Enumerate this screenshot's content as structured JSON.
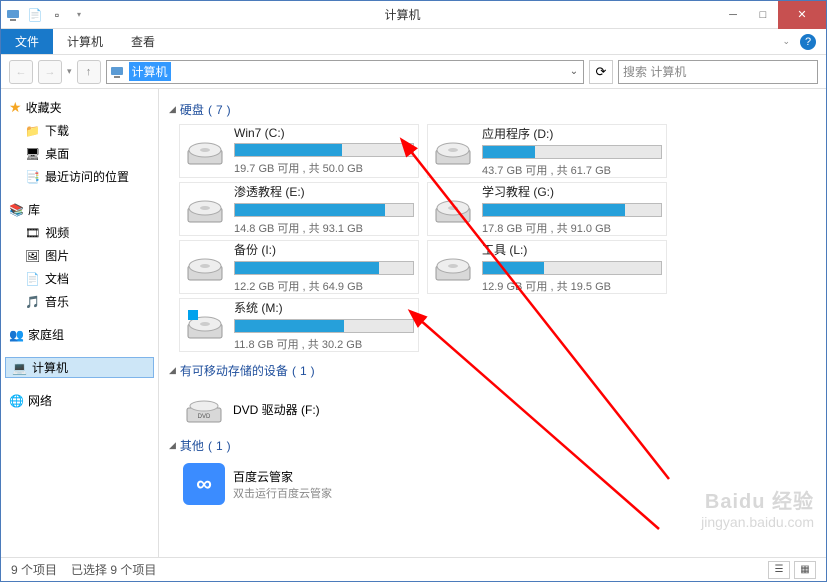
{
  "titlebar": {
    "title": "计算机"
  },
  "menubar": {
    "file": "文件",
    "computer": "计算机",
    "view": "查看"
  },
  "navbar": {
    "address": "计算机",
    "search_placeholder": "搜索 计算机"
  },
  "sidebar": {
    "favorites": {
      "label": "收藏夹",
      "items": [
        "下载",
        "桌面",
        "最近访问的位置"
      ]
    },
    "libraries": {
      "label": "库",
      "items": [
        "视频",
        "图片",
        "文档",
        "音乐"
      ]
    },
    "homegroup": "家庭组",
    "computer": "计算机",
    "network": "网络"
  },
  "sections": {
    "hdd": {
      "label": "硬盘",
      "count": 7
    },
    "removable": {
      "label": "有可移动存储的设备",
      "count": 1
    },
    "other": {
      "label": "其他",
      "count": 1
    }
  },
  "drives": [
    {
      "name": "Win7 (C:)",
      "free": "19.7 GB",
      "total": "50.0 GB",
      "pct": 60
    },
    {
      "name": "应用程序 (D:)",
      "free": "43.7 GB",
      "total": "61.7 GB",
      "pct": 29
    },
    {
      "name": "渗透教程 (E:)",
      "free": "14.8 GB",
      "total": "93.1 GB",
      "pct": 84
    },
    {
      "name": "学习教程 (G:)",
      "free": "17.8 GB",
      "total": "91.0 GB",
      "pct": 80
    },
    {
      "name": "备份 (I:)",
      "free": "12.2 GB",
      "total": "64.9 GB",
      "pct": 81
    },
    {
      "name": "工具 (L:)",
      "free": "12.9 GB",
      "total": "19.5 GB",
      "pct": 34
    },
    {
      "name": "系统 (M:)",
      "free": "11.8 GB",
      "total": "30.2 GB",
      "pct": 61,
      "win": true
    }
  ],
  "dvd": {
    "label": "DVD 驱动器 (F:)"
  },
  "baidu": {
    "label": "百度云管家",
    "sub": "双击运行百度云管家"
  },
  "statusbar": {
    "count": "9 个项目",
    "selected": "已选择 9 个项目"
  },
  "watermark": {
    "brand": "Baidu 经验",
    "url": "jingyan.baidu.com"
  }
}
